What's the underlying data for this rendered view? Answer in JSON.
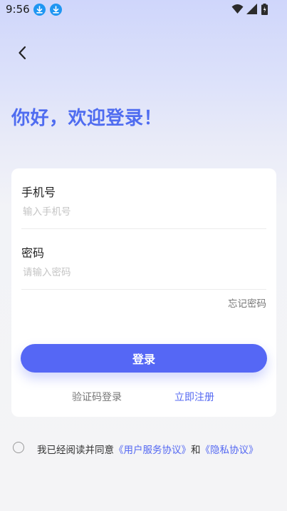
{
  "status_bar": {
    "time": "9:56",
    "icons": [
      "download-icon",
      "download-icon",
      "wifi-icon",
      "signal-icon",
      "battery-icon"
    ]
  },
  "header": {
    "back_icon": "chevron-left-icon",
    "greeting": "你好，欢迎登录！"
  },
  "form": {
    "phone": {
      "label": "手机号",
      "placeholder": "输入手机号",
      "value": ""
    },
    "password": {
      "label": "密码",
      "placeholder": "请输入密码",
      "value": ""
    },
    "forgot_password": "忘记密码",
    "login_button": "登录",
    "sms_login": "验证码登录",
    "register": "立即注册"
  },
  "agreement": {
    "checked": false,
    "prefix": "我已经阅读并同意",
    "user_agreement": "《用户服务协议》",
    "conjunction": "和",
    "privacy_policy": "《隐私协议》"
  },
  "colors": {
    "accent": "#5567f5",
    "link": "#5468f2",
    "greeting": "#4f6cf0",
    "download_badge": "#1f96f2"
  }
}
